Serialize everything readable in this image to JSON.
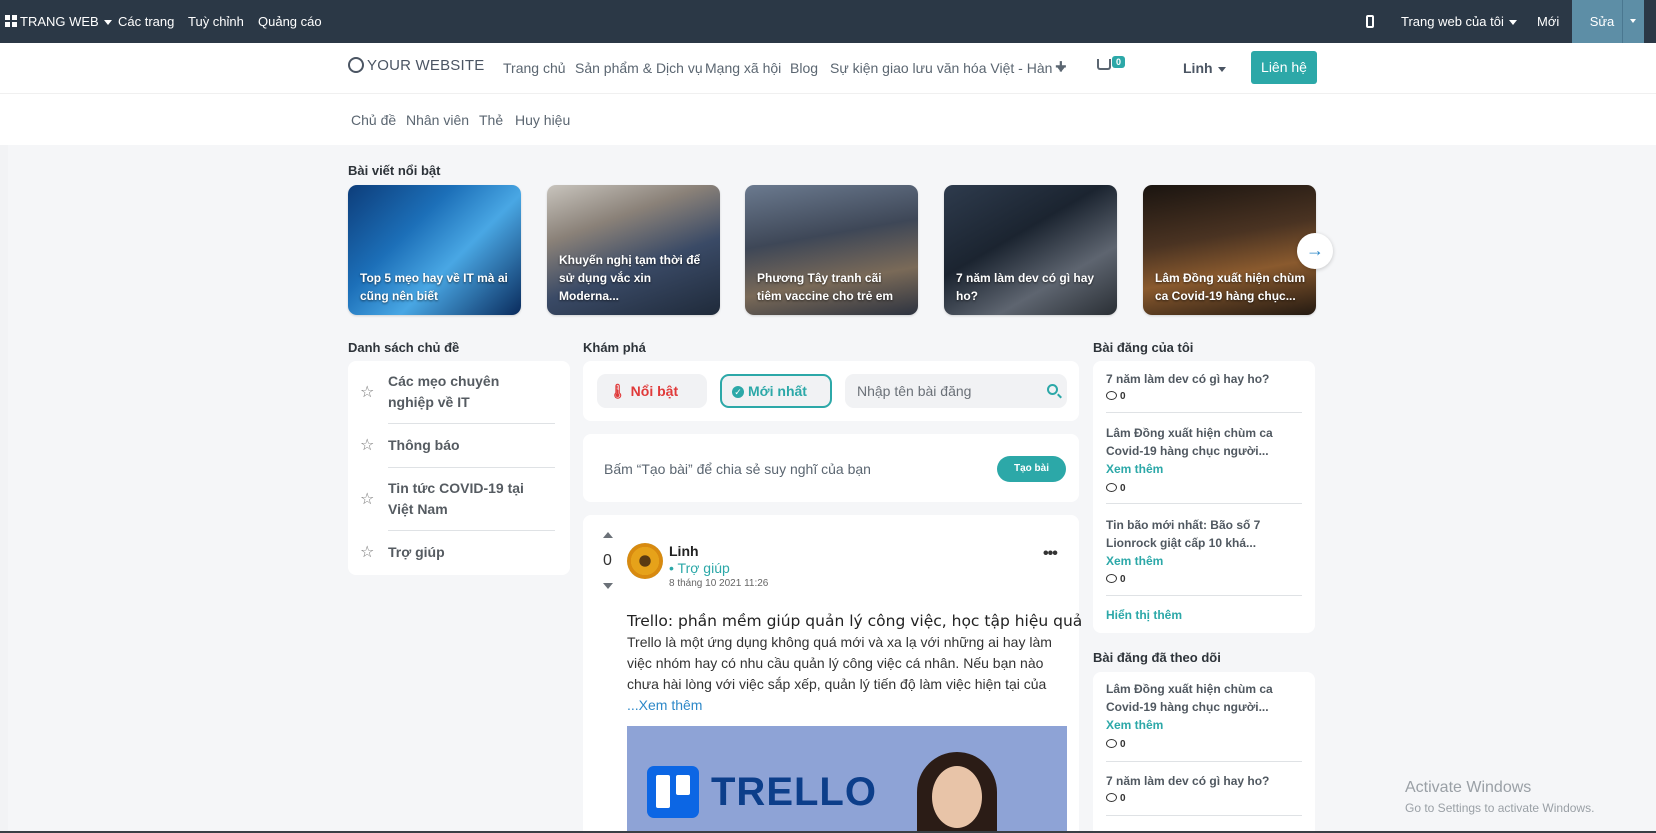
{
  "admin_bar": {
    "site_menu": "TRANG WEB",
    "pages": "Các trang",
    "customize": "Tuỳ chỉnh",
    "promote": "Quảng cáo",
    "my_website": "Trang web của tôi",
    "new": "Mới",
    "edit": "Sửa"
  },
  "header": {
    "logo": "YOUR WEBSITE",
    "nav": [
      "Trang chủ",
      "Sản phẩm & Dịch vụ",
      "Mạng xã hội",
      "Blog",
      "Sự kiện giao lưu văn hóa Việt - Hàn"
    ],
    "cart_count": "0",
    "user": "Linh",
    "contact": "Liên hệ"
  },
  "sub_nav": [
    "Chủ đề",
    "Nhân viên",
    "Thẻ",
    "Huy hiệu"
  ],
  "featured": {
    "title": "Bài viết nổi bật",
    "cards": [
      "Top 5 mẹo hay về IT mà ai cũng nên biết",
      "Khuyến nghị tạm thời để sử dụng vắc xin Moderna...",
      "Phương Tây tranh cãi tiêm vaccine cho trẻ em",
      "7 năm làm dev có gì hay ho?",
      "Lâm Đồng xuất hiện chùm ca Covid-19 hàng chục..."
    ],
    "next_icon": "arrow-right-icon"
  },
  "topics": {
    "title": "Danh sách chủ đề",
    "items": [
      "Các mẹo chuyên nghiệp về IT",
      "Thông báo",
      "Tin tức COVID-19 tại Việt Nam",
      "Trợ giúp"
    ]
  },
  "explore": {
    "title": "Khám phá",
    "tab_hot": "Nổi bật",
    "tab_new": "Mới nhất",
    "search_placeholder": "Nhập tên bài đăng",
    "create_prompt": "Bấm “Tạo bài” để chia sẻ suy nghĩ của bạn",
    "create_button": "Tạo bài"
  },
  "post": {
    "votes": "0",
    "author": "Linh",
    "topic": "• Trợ giúp",
    "date": "8 tháng 10 2021 11:26",
    "title": "Trello: phần mềm giúp quản lý công việc, học tập hiệu quả",
    "body": "Trello là một ứng dụng không quá mới và xa lạ với những ai hay làm việc nhóm hay có nhu cầu quản lý công việc cá nhân. Nếu bạn nào chưa hài lòng với việc sắp xếp, quản lý tiến độ làm việc hiện tại của",
    "read_more": "...Xem thêm",
    "image_text": "TRELLO"
  },
  "my_posts": {
    "title": "Bài đăng của tôi",
    "items": [
      {
        "text": "7 năm làm dev có gì hay ho?",
        "more": "",
        "count": "0"
      },
      {
        "text": "Lâm Đồng xuất hiện chùm ca Covid-19 hàng chục người...",
        "more": "Xem thêm",
        "count": "0"
      },
      {
        "text": "Tin bão mới nhất: Bão số 7 Lionrock giật cấp 10 khá...",
        "more": "Xem thêm",
        "count": "0"
      }
    ],
    "show_more": "Hiển thị thêm"
  },
  "followed_posts": {
    "title": "Bài đăng đã theo dõi",
    "items": [
      {
        "text": "Lâm Đồng xuất hiện chùm ca Covid-19 hàng chục người...",
        "more": "Xem thêm",
        "count": "0"
      },
      {
        "text": "7 năm làm dev có gì hay ho?",
        "more": "",
        "count": "0"
      }
    ]
  },
  "watermark": {
    "line1": "Activate Windows",
    "line2": "Go to Settings to activate Windows."
  }
}
